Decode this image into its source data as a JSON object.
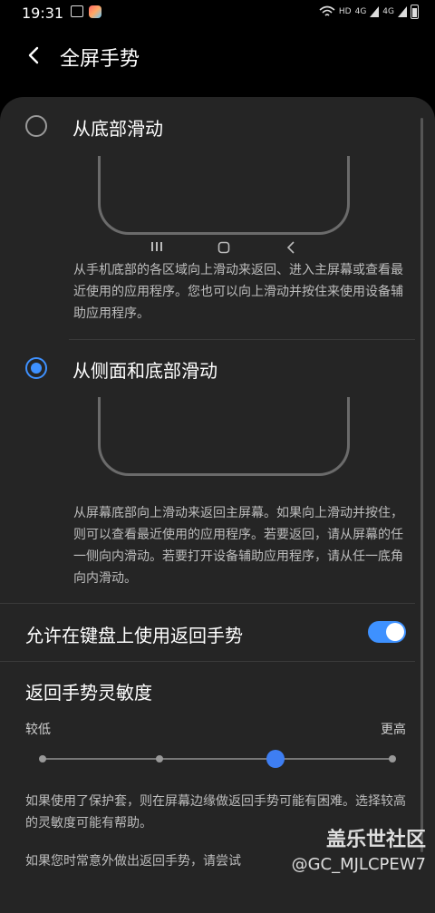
{
  "status_bar": {
    "time": "19:31",
    "hd": "HD",
    "net1": "4G",
    "net2": "4G"
  },
  "header": {
    "title": "全屏手势",
    "back_icon": "chevron-left-icon"
  },
  "options": [
    {
      "label": "从底部滑动",
      "selected": false,
      "description": "从手机底部的各区域向上滑动来返回、进入主屏幕或查看最近使用的应用程序。您也可以向上滑动并按住来使用设备辅助应用程序。",
      "nav_keys": [
        "recents-icon",
        "home-icon",
        "back-icon"
      ]
    },
    {
      "label": "从侧面和底部滑动",
      "selected": true,
      "description": "从屏幕底部向上滑动来返回主屏幕。如果向上滑动并按住，则可以查看最近使用的应用程序。若要返回，请从屏幕的任一侧向内滑动。若要打开设备辅助应用程序，请从任一底角向内滑动。"
    }
  ],
  "keyboard_gesture": {
    "label": "允许在键盘上使用返回手势",
    "enabled": true
  },
  "sensitivity": {
    "title": "返回手势灵敏度",
    "low_label": "较低",
    "high_label": "更高",
    "steps": 4,
    "value": 3
  },
  "notes": {
    "note1": "如果使用了保护套，则在屏幕边缘做返回手势可能有困难。选择较高的灵敏度可能有帮助。",
    "note2": "如果您时常意外做出返回手势，请尝试"
  },
  "watermark": {
    "brand": "盖乐世社区",
    "user": "@GC_MJLCPEW7"
  },
  "colors": {
    "accent": "#3e91ff",
    "panel": "#252525",
    "background": "#000000"
  }
}
